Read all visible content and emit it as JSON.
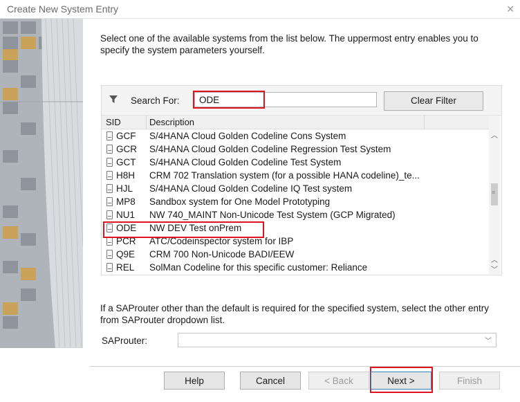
{
  "window": {
    "title": "Create New System Entry",
    "close_icon": "close-icon"
  },
  "intro": "Select one of the available systems from the list below. The uppermost entry enables you to specify the system parameters yourself.",
  "filter": {
    "icon": "funnel-icon",
    "search_label": "Search For:",
    "search_value": "ODE",
    "clear_label": "Clear Filter"
  },
  "columns": {
    "sid": "SID",
    "description": "Description"
  },
  "systems": [
    {
      "sid": "GCF",
      "description": "S/4HANA Cloud Golden Codeline Cons System"
    },
    {
      "sid": "GCR",
      "description": "S/4HANA Cloud Golden Codeline Regression Test System"
    },
    {
      "sid": "GCT",
      "description": "S/4HANA Cloud Golden Codeline Test System"
    },
    {
      "sid": "H8H",
      "description": "CRM 702 Translation system (for a possible HANA codeline)_te..."
    },
    {
      "sid": "HJL",
      "description": "S/4HANA Cloud  Golden Codeline IQ Test system"
    },
    {
      "sid": "MP8",
      "description": "Sandbox system for One Model Prototyping"
    },
    {
      "sid": "NU1",
      "description": "NW 740_MAINT Non-Unicode Test System (GCP Migrated)"
    },
    {
      "sid": "ODE",
      "description": "NW DEV Test onPrem"
    },
    {
      "sid": "PCR",
      "description": "ATC/Codeinspector system for IBP"
    },
    {
      "sid": "Q9E",
      "description": "CRM 700 Non-Unicode BADI/EEW"
    },
    {
      "sid": "REL",
      "description": "SolMan Codeline for this specific customer: Reliance"
    }
  ],
  "router": {
    "note": "If a SAProuter other than the default is required for the specified system, select the other entry from SAProuter dropdown list.",
    "label": "SAProuter:",
    "value": ""
  },
  "buttons": {
    "help": "Help",
    "cancel": "Cancel",
    "back": "< Back",
    "next": "Next >",
    "finish": "Finish"
  },
  "colors": {
    "highlight": "#e0141e"
  }
}
